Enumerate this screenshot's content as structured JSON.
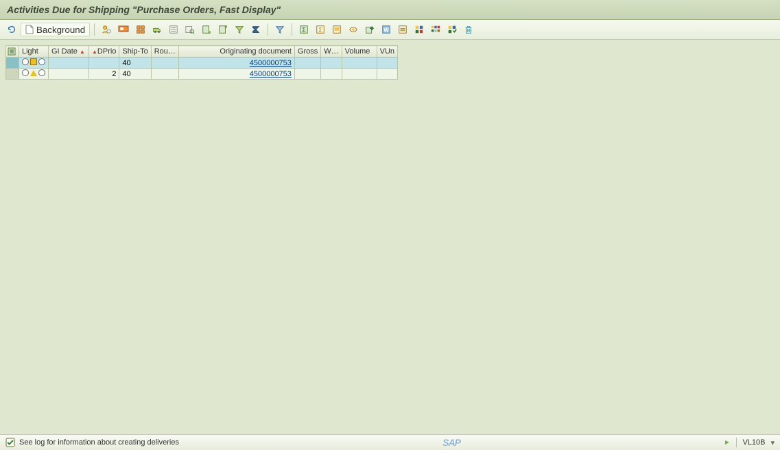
{
  "title": "Activities Due for Shipping \"Purchase Orders, Fast Display\"",
  "toolbar": {
    "refresh": "Refresh",
    "background_label": "Background",
    "icons": {
      "user_settings": "user-settings",
      "dialog": "dialog",
      "select_all_items": "select-all-items-hierarchy",
      "deliver": "deliver",
      "details": "details",
      "columns": "columns",
      "sort_asc": "sort-ascending",
      "sort_desc": "sort-descending",
      "filter": "filter-set",
      "filter_reset": "filter-reset",
      "total": "total",
      "subtotal": "subtotal",
      "print": "print",
      "view": "view",
      "export": "export",
      "layout_select": "layout-select",
      "layout_change": "layout-change",
      "layout_save": "layout-save",
      "layout_admin": "layout-admin",
      "info": "info",
      "delete": "delete",
      "separator": "separator"
    }
  },
  "grid": {
    "columns": {
      "select": "",
      "light": "Light",
      "gi_date": "GI Date",
      "dprio": "DPrio",
      "ship_to": "Ship-To",
      "route": "Rou…",
      "orig_doc": "Originating document",
      "gross": "Gross",
      "wun": "W…",
      "volume": "Volume",
      "vun": "VUn"
    },
    "rows": [
      {
        "selected": true,
        "light_kind": "square",
        "gi_date": "",
        "dprio": "",
        "ship_to": "40",
        "route": "",
        "orig_doc": "4500000753",
        "gross": "",
        "wun": "",
        "volume": "",
        "vun": ""
      },
      {
        "selected": false,
        "light_kind": "triangle",
        "gi_date": "",
        "dprio": "2",
        "ship_to": "40",
        "route": "",
        "orig_doc": "4500000753",
        "gross": "",
        "wun": "",
        "volume": "",
        "vun": ""
      }
    ]
  },
  "statusbar": {
    "message": "See log for information about creating deliveries",
    "tcode": "VL10B"
  }
}
